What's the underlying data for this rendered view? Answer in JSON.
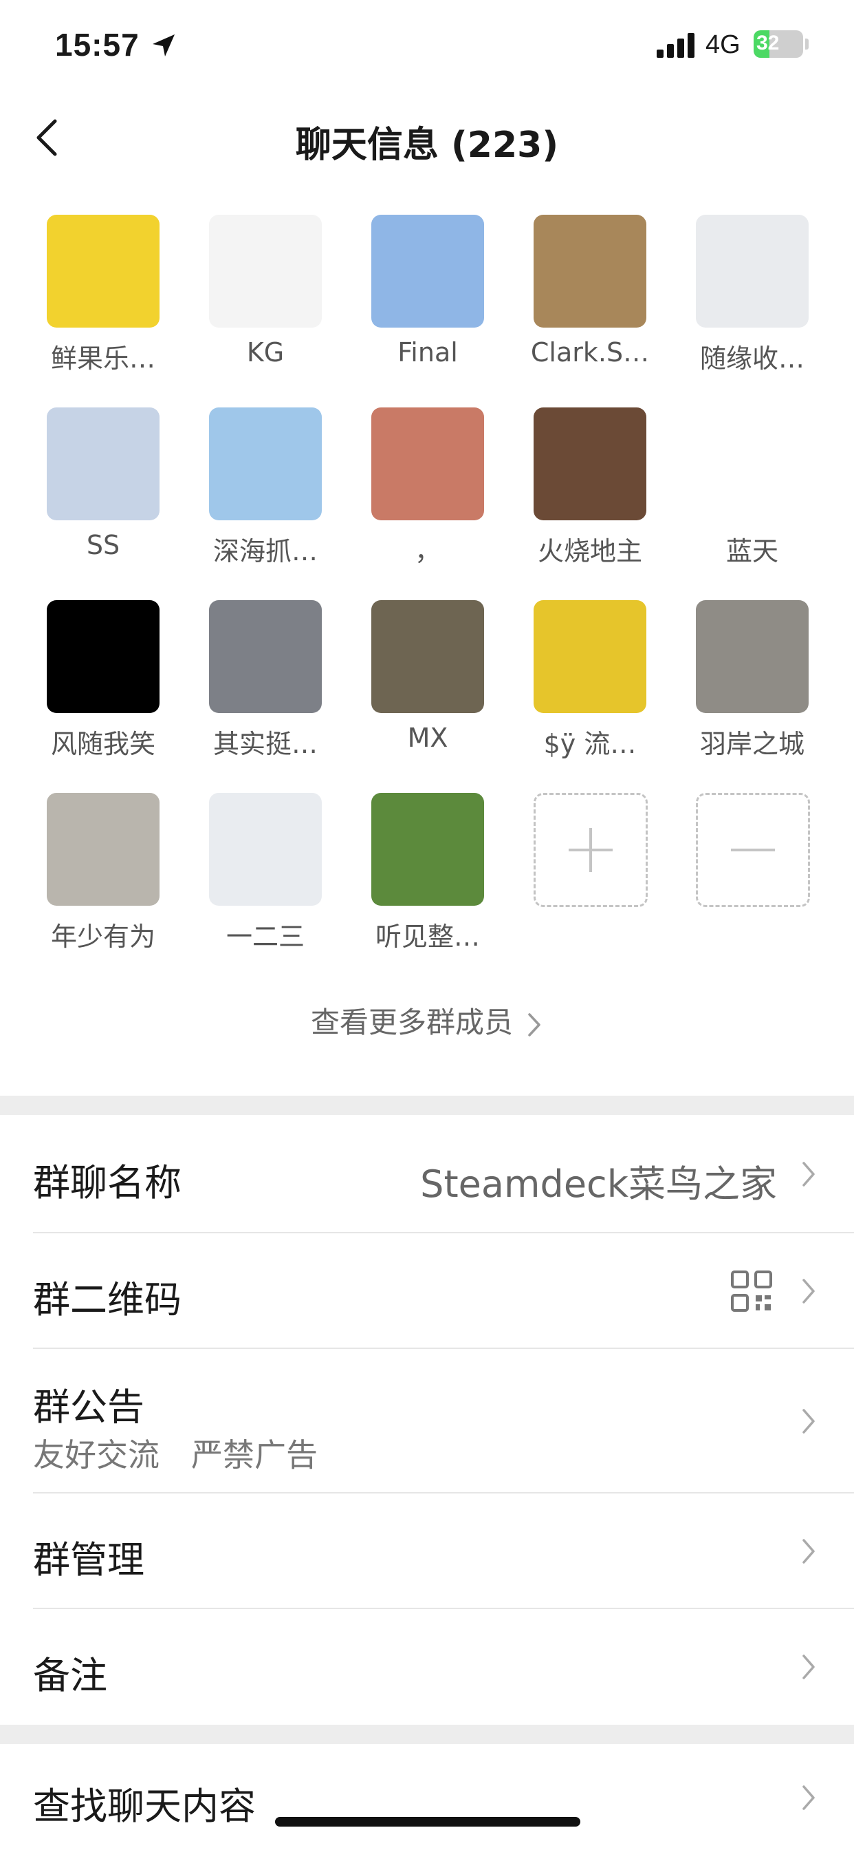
{
  "status_bar": {
    "time": "15:57",
    "network": "4G",
    "battery": "32",
    "battery_level": 0.32,
    "location_icon": "location-arrow-icon",
    "signal_icon": "signal-bars-icon"
  },
  "nav": {
    "title": "聊天信息 (223)",
    "back_icon": "chevron-left-icon"
  },
  "members": [
    {
      "name": "鲜果乐…",
      "avatar_color": "#f2d22e"
    },
    {
      "name": "KG",
      "avatar_color": "#f4f4f4"
    },
    {
      "name": "Final",
      "avatar_color": "#8fb6e6"
    },
    {
      "name": "Clark.S…",
      "avatar_color": "#a8875a"
    },
    {
      "name": "随缘收…",
      "avatar_color": "#e9ebee"
    },
    {
      "name": "SS",
      "avatar_color": "#c6d3e6"
    },
    {
      "name": "深海抓…",
      "avatar_color": "#9fc7ea"
    },
    {
      "name": "，",
      "avatar_color": "#c97a66"
    },
    {
      "name": "火烧地主",
      "avatar_color": "#6b4a36"
    },
    {
      "name": "蓝天",
      "avatar_color": "#ffffff"
    },
    {
      "name": "风随我笑",
      "avatar_color": "#000000"
    },
    {
      "name": "其实挺…",
      "avatar_color": "#7d8087"
    },
    {
      "name": "MX",
      "avatar_color": "#6e6552"
    },
    {
      "name": "$ÿ 流…",
      "avatar_color": "#e6c52b"
    },
    {
      "name": "羽岸之城",
      "avatar_color": "#8f8c86"
    },
    {
      "name": "年少有为",
      "avatar_color": "#b9b5ad"
    },
    {
      "name": "一二三",
      "avatar_color": "#e9ecf0"
    },
    {
      "name": "听见整…",
      "avatar_color": "#5c8a3c"
    }
  ],
  "add_member_icon": "plus-icon",
  "remove_member_icon": "minus-icon",
  "see_more": "查看更多群成员",
  "settings": {
    "group_name_label": "群聊名称",
    "group_name_value": "Steamdeck菜鸟之家",
    "qr_label": "群二维码",
    "qr_icon": "qr-code-icon",
    "notice_label": "群公告",
    "notice_value": "友好交流　严禁广告",
    "manage_label": "群管理",
    "remark_label": "备注",
    "search_label": "查找聊天内容"
  }
}
